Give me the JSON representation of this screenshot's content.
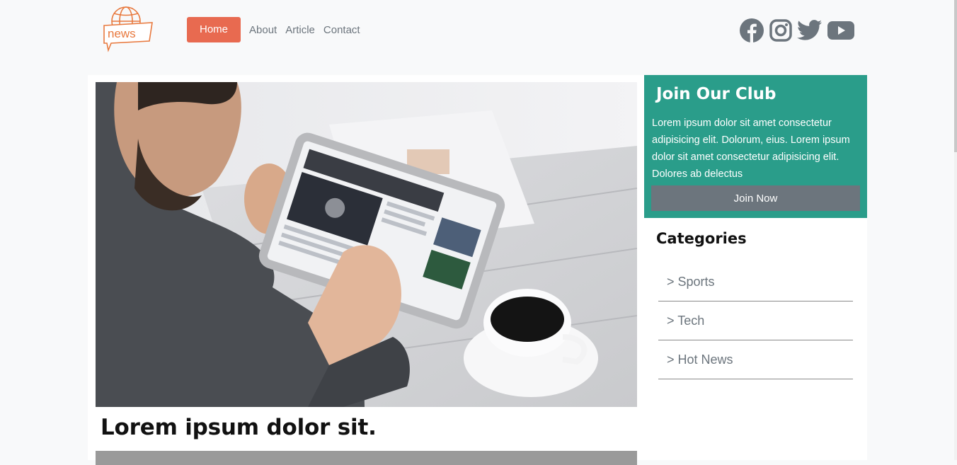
{
  "brand": {
    "logo_text": "news",
    "logo_color": "#e8793e"
  },
  "nav": {
    "items": [
      {
        "label": "Home",
        "active": true
      },
      {
        "label": "About"
      },
      {
        "label": "Article"
      },
      {
        "label": "Contact"
      }
    ],
    "accent": "#e86a50"
  },
  "social": {
    "icons": [
      "facebook-icon",
      "instagram-icon",
      "twitter-icon",
      "youtube-icon"
    ],
    "color": "#6c757d"
  },
  "main": {
    "image": "man-using-tablet-with-coffee",
    "headline": "Lorem ipsum dolor sit."
  },
  "club": {
    "title": "Join Our Club",
    "text": "Lorem ipsum dolor sit amet consectetur adipisicing elit. Dolorum, eius. Lorem ipsum dolor sit amet consectetur adipisicing elit. Dolores ab delectus",
    "button": "Join Now",
    "bg": "#2a9d8a"
  },
  "categories": {
    "title": "Categories",
    "items": [
      "> Sports",
      "> Tech",
      "> Hot News"
    ]
  }
}
